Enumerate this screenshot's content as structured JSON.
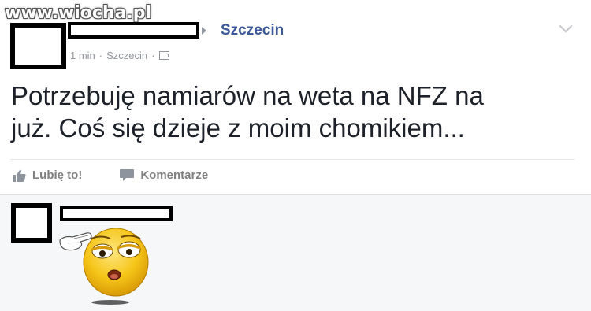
{
  "watermark": "www.wiocha.pl",
  "post": {
    "location": "Szczecin",
    "timestamp": "1 min",
    "place": "Szczecin",
    "separator": "·",
    "text_line1": "Potrzebuję namiarów na weta na NFZ na",
    "text_line2": "już. Coś się dzieje z moim chomikiem...",
    "like_label": "Lubię to!",
    "comment_label": "Komentarze"
  },
  "icons": {
    "like": "thumbs-up-icon",
    "comment": "speech-bubble-icon",
    "privacy": "privacy-icon",
    "options": "chevron-down-icon"
  },
  "colors": {
    "link": "#3b5998",
    "meta": "#90949c",
    "text": "#1d2129",
    "comment_bg": "#f6f7f9",
    "emoji": "#f5c518"
  }
}
